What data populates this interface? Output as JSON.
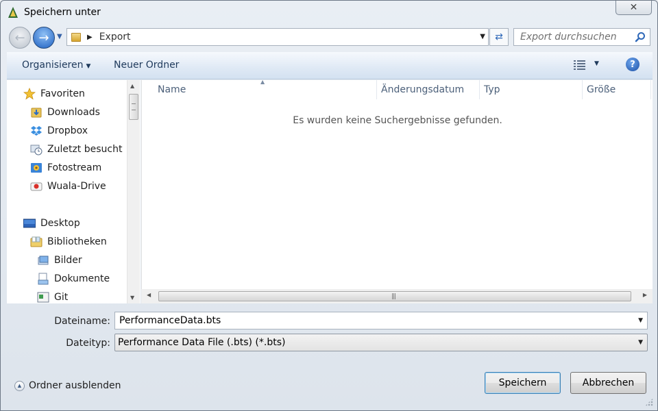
{
  "window": {
    "title": "Speichern unter",
    "close_glyph": "✕"
  },
  "nav": {
    "address_path": "Export",
    "search_placeholder": "Export durchsuchen"
  },
  "toolbar": {
    "organize_label": "Organisieren",
    "new_folder_label": "Neuer Ordner",
    "help_label": "?"
  },
  "sidebar": {
    "favorites_header": "Favoriten",
    "favorites": [
      {
        "label": "Downloads",
        "icon": "downloads-folder-icon"
      },
      {
        "label": "Dropbox",
        "icon": "dropbox-icon"
      },
      {
        "label": "Zuletzt besucht",
        "icon": "recent-places-icon"
      },
      {
        "label": "Fotostream",
        "icon": "photostream-icon"
      },
      {
        "label": "Wuala-Drive",
        "icon": "wuala-drive-icon"
      }
    ],
    "desktop_label": "Desktop",
    "libraries_label": "Bibliotheken",
    "libraries": [
      {
        "label": "Bilder",
        "icon": "pictures-library-icon"
      },
      {
        "label": "Dokumente",
        "icon": "documents-library-icon"
      },
      {
        "label": "Git",
        "icon": "git-library-icon"
      }
    ]
  },
  "file_list": {
    "columns": [
      "Name",
      "Änderungsdatum",
      "Typ",
      "Größe"
    ],
    "empty_message": "Es wurden keine Suchergebnisse gefunden."
  },
  "form": {
    "filename_label": "Dateiname:",
    "filename_value": "PerformanceData.bts",
    "filetype_label": "Dateityp:",
    "filetype_value": "Performance Data File (.bts) (*.bts)",
    "hide_folders_label": "Ordner ausblenden",
    "save_label": "Speichern",
    "cancel_label": "Abbrechen"
  },
  "colors": {
    "toolbar_text": "#1e395b",
    "accent_blue": "#1d5fc0"
  }
}
